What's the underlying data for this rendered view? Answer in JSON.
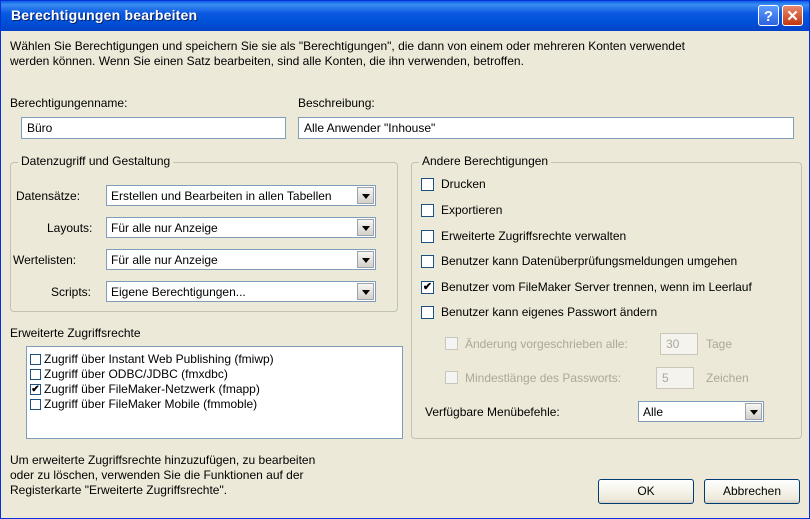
{
  "window": {
    "title": "Berechtigungen bearbeiten",
    "help_label": "?",
    "close_label": "✕"
  },
  "intro": {
    "line1": "Wählen Sie Berechtigungen und speichern Sie sie als \"Berechtigungen\", die dann von einem oder mehreren Konten verwendet",
    "line2": "werden können. Wenn Sie einen Satz bearbeiten, sind alle Konten, die ihn verwenden, betroffen."
  },
  "name_field": {
    "label": "Berechtigungenname:",
    "value": "Büro"
  },
  "desc_field": {
    "label": "Beschreibung:",
    "value": "Alle Anwender \"Inhouse\""
  },
  "data_access": {
    "title": "Datenzugriff und Gestaltung",
    "rows": [
      {
        "label": "Datensätze:",
        "value": "Erstellen und Bearbeiten in allen Tabellen"
      },
      {
        "label": "Layouts:",
        "value": "Für alle nur Anzeige"
      },
      {
        "label": "Wertelisten:",
        "value": "Für alle nur Anzeige"
      },
      {
        "label": "Scripts:",
        "value": "Eigene Berechtigungen..."
      }
    ]
  },
  "extended": {
    "title": "Erweiterte Zugriffsrechte",
    "items": [
      {
        "label": "Zugriff über Instant Web Publishing (fmiwp)",
        "checked": false
      },
      {
        "label": "Zugriff über ODBC/JDBC (fmxdbc)",
        "checked": false
      },
      {
        "label": "Zugriff über FileMaker-Netzwerk (fmapp)",
        "checked": true
      },
      {
        "label": "Zugriff über FileMaker Mobile (fmmoble)",
        "checked": false
      }
    ],
    "help_line1": "Um erweiterte Zugriffsrechte hinzuzufügen, zu bearbeiten",
    "help_line2": "oder zu löschen, verwenden Sie die Funktionen auf der",
    "help_line3": "Registerkarte \"Erweiterte Zugriffsrechte\"."
  },
  "other": {
    "title": "Andere Berechtigungen",
    "checks": [
      {
        "label": "Drucken",
        "checked": false
      },
      {
        "label": "Exportieren",
        "checked": false
      },
      {
        "label": "Erweiterte Zugriffsrechte verwalten",
        "checked": false
      },
      {
        "label": "Benutzer kann Datenüberprüfungsmeldungen umgehen",
        "checked": false
      },
      {
        "label": "Benutzer vom FileMaker Server trennen, wenn im Leerlauf",
        "checked": true
      },
      {
        "label": "Benutzer kann eigenes Passwort ändern",
        "checked": false
      }
    ],
    "pw_change": {
      "label": "Änderung vorgeschrieben alle:",
      "value": "30",
      "unit": "Tage"
    },
    "pw_length": {
      "label": "Mindestlänge des Passworts:",
      "value": "5",
      "unit": "Zeichen"
    },
    "menu": {
      "label": "Verfügbare Menübefehle:",
      "value": "Alle"
    }
  },
  "buttons": {
    "ok": "OK",
    "cancel": "Abbrechen"
  },
  "check_mark": "✔"
}
